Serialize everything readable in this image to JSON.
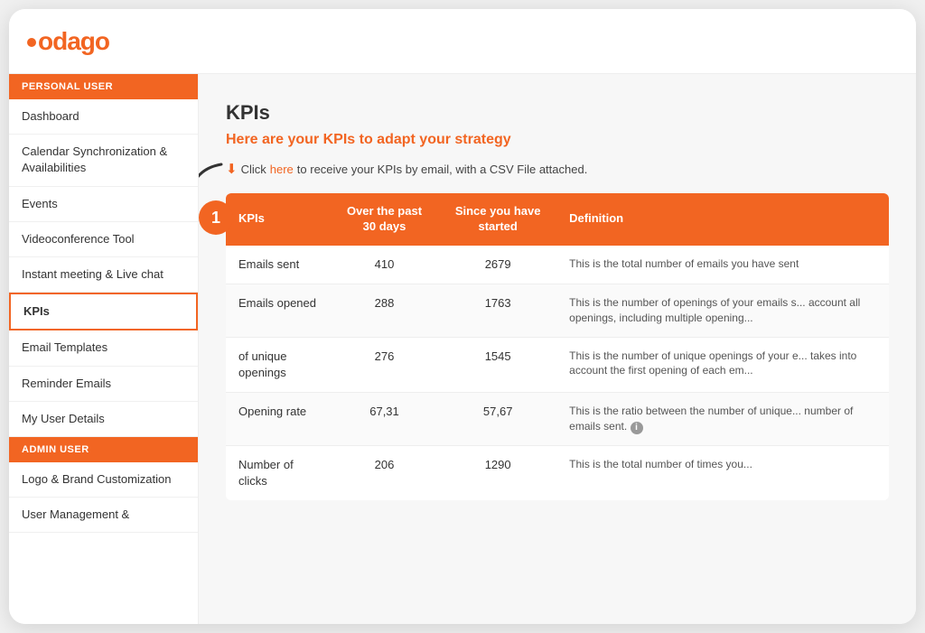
{
  "logo": {
    "text": "odago"
  },
  "sidebar": {
    "sections": [
      {
        "label": "PERSONAL USER",
        "items": [
          {
            "id": "dashboard",
            "label": "Dashboard",
            "active": false
          },
          {
            "id": "calendar",
            "label": "Calendar Synchronization & Availabilities",
            "active": false
          },
          {
            "id": "events",
            "label": "Events",
            "active": false
          },
          {
            "id": "videoconference",
            "label": "Videoconference Tool",
            "active": false
          },
          {
            "id": "instant-meeting",
            "label": "Instant meeting & Live chat",
            "active": false
          },
          {
            "id": "kpis",
            "label": "KPIs",
            "active": true
          },
          {
            "id": "email-templates",
            "label": "Email Templates",
            "active": false
          },
          {
            "id": "reminder-emails",
            "label": "Reminder Emails",
            "active": false
          },
          {
            "id": "my-user-details",
            "label": "My User Details",
            "active": false
          }
        ]
      },
      {
        "label": "ADMIN USER",
        "items": [
          {
            "id": "logo-brand",
            "label": "Logo & Brand Customization",
            "active": false
          },
          {
            "id": "user-management",
            "label": "User Management &",
            "active": false
          }
        ]
      }
    ]
  },
  "main": {
    "title": "KPIs",
    "subtitle": "Here are your KPIs to adapt your strategy",
    "email_notice_prefix": " Click ",
    "email_notice_link": "here",
    "email_notice_suffix": " to receive your KPIs by email, with a CSV File attached.",
    "table": {
      "headers": [
        "KPIs",
        "Over the past 30 days",
        "Since you have started",
        "Definition"
      ],
      "rows": [
        {
          "kpi": "Emails sent",
          "past30": "410",
          "since_start": "2679",
          "definition": "This is the total number of emails you have sent"
        },
        {
          "kpi": "Emails opened",
          "past30": "288",
          "since_start": "1763",
          "definition": "This is the number of openings of your emails s... account all openings, including multiple opening..."
        },
        {
          "kpi": "of unique openings",
          "past30": "276",
          "since_start": "1545",
          "definition": "This is the number of unique openings of your e... takes into account the first opening of each em..."
        },
        {
          "kpi": "Opening rate",
          "past30": "67,31",
          "since_start": "57,67",
          "definition": "This is the ratio between the number of unique... number of emails sent."
        },
        {
          "kpi": "Number of clicks",
          "past30": "206",
          "since_start": "1290",
          "definition": "This is the total number of times you..."
        }
      ]
    }
  },
  "annotation": {
    "badge_number": "1"
  }
}
